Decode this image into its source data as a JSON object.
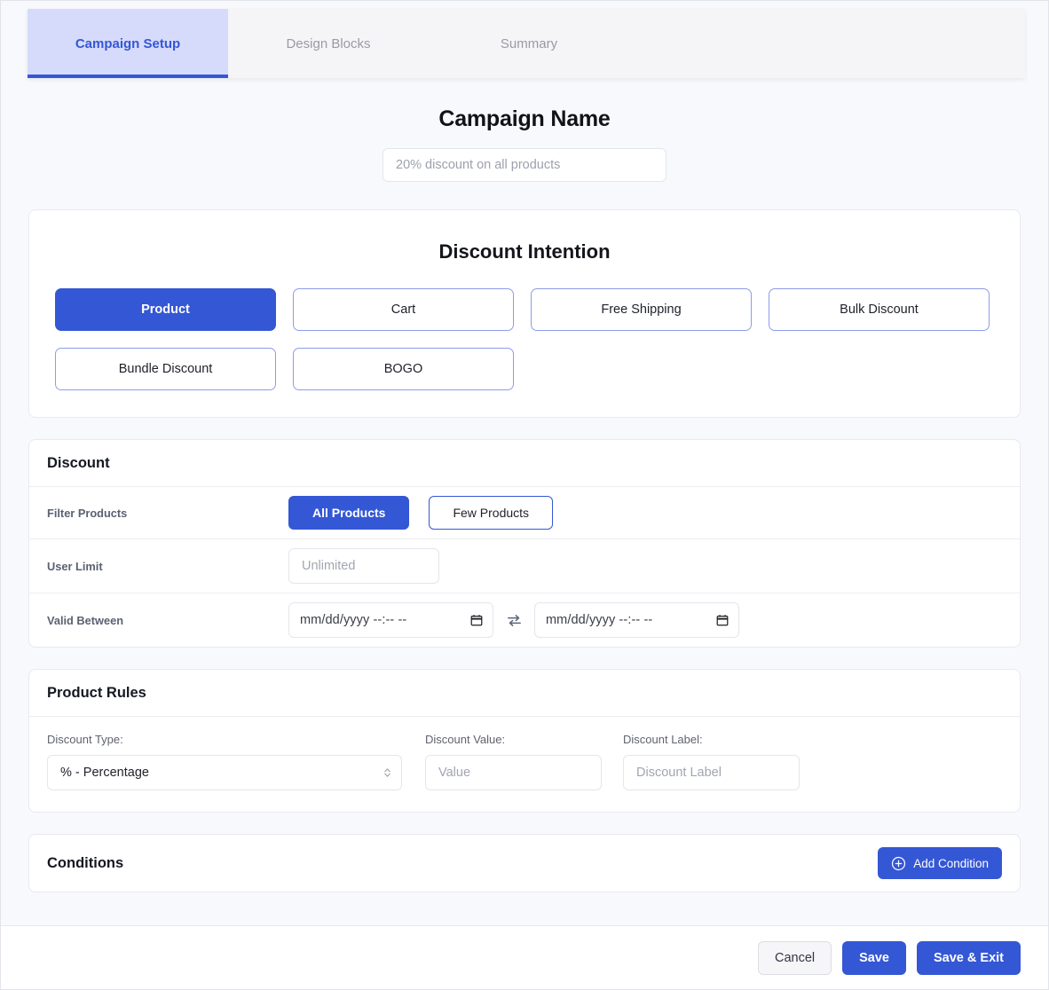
{
  "tabs": [
    {
      "label": "Campaign Setup",
      "active": true
    },
    {
      "label": "Design Blocks",
      "active": false
    },
    {
      "label": "Summary",
      "active": false
    }
  ],
  "campaign": {
    "title": "Campaign Name",
    "name_value": "",
    "name_placeholder": "20% discount on all products"
  },
  "intention": {
    "title": "Discount Intention",
    "options": [
      {
        "label": "Product",
        "selected": true
      },
      {
        "label": "Cart",
        "selected": false
      },
      {
        "label": "Free Shipping",
        "selected": false
      },
      {
        "label": "Bulk Discount",
        "selected": false
      },
      {
        "label": "Bundle Discount",
        "selected": false
      },
      {
        "label": "BOGO",
        "selected": false
      }
    ]
  },
  "discount": {
    "title": "Discount",
    "filter_products": {
      "label": "Filter Products",
      "options": [
        {
          "label": "All Products",
          "selected": true
        },
        {
          "label": "Few Products",
          "selected": false
        }
      ]
    },
    "user_limit": {
      "label": "User Limit",
      "value": "",
      "placeholder": "Unlimited"
    },
    "valid_between": {
      "label": "Valid Between",
      "start_text": "mm/dd/yyyy --:-- --",
      "end_text": "mm/dd/yyyy --:-- --",
      "swap_icon": "exchange-arrows-icon",
      "calendar_icon": "calendar-icon"
    }
  },
  "product_rules": {
    "title": "Product Rules",
    "discount_type": {
      "label": "Discount Type:",
      "value": "% - Percentage",
      "icon": "stepper-chevrons-icon"
    },
    "discount_value": {
      "label": "Discount Value:",
      "value": "",
      "placeholder": "Value"
    },
    "discount_label": {
      "label": "Discount Label:",
      "value": "",
      "placeholder": "Discount Label"
    }
  },
  "conditions": {
    "title": "Conditions",
    "add_button": "Add Condition",
    "add_icon": "plus-circle-icon"
  },
  "footer": {
    "cancel": "Cancel",
    "save": "Save",
    "save_exit": "Save & Exit"
  },
  "colors": {
    "primary": "#3457d5",
    "tab_active_bg": "#d6dbfc",
    "page_bg": "#f8f9fc",
    "card_bg": "#ffffff",
    "border": "#e8eaf0",
    "muted_text": "#9a9aa6"
  }
}
